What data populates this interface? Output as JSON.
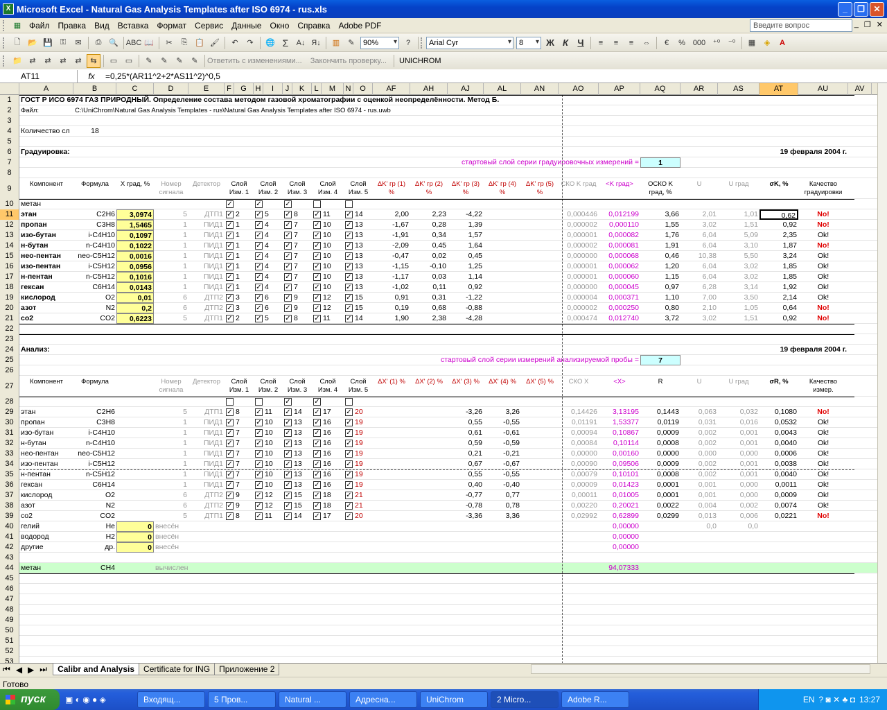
{
  "window": {
    "title": "Microsoft Excel - Natural Gas Analysis Templates after ISO 6974 - rus.xls"
  },
  "menu": [
    "Файл",
    "Правка",
    "Вид",
    "Вставка",
    "Формат",
    "Сервис",
    "Данные",
    "Окно",
    "Справка",
    "Adobe PDF"
  ],
  "ask_placeholder": "Введите вопрос",
  "toolbar": {
    "zoom": "90%",
    "font": "Arial Cyr",
    "size": "8",
    "bold": "Ж",
    "italic": "К",
    "underline": "Ч",
    "percent": "%",
    "thousands": "000",
    "sum": "Σ",
    "review_reply": "Ответить с изменениями...",
    "review_end": "Закончить проверку...",
    "unichrom": "UNICHROM"
  },
  "formula_bar": {
    "cell": "AT11",
    "fx": "fx",
    "formula": "=0,25*(AR11^2+2*AS11^2)^0,5"
  },
  "columns": [
    {
      "n": "A",
      "w": 78
    },
    {
      "n": "B",
      "w": 62
    },
    {
      "n": "C",
      "w": 54
    },
    {
      "n": "D",
      "w": 50
    },
    {
      "n": "E",
      "w": 52
    },
    {
      "n": "F",
      "w": 14
    },
    {
      "n": "G",
      "w": 28
    },
    {
      "n": "H",
      "w": 14
    },
    {
      "n": "I",
      "w": 28
    },
    {
      "n": "J",
      "w": 14
    },
    {
      "n": "K",
      "w": 28
    },
    {
      "n": "L",
      "w": 14
    },
    {
      "n": "M",
      "w": 32
    },
    {
      "n": "N",
      "w": 14
    },
    {
      "n": "O",
      "w": 28
    },
    {
      "n": "AF",
      "w": 54
    },
    {
      "n": "AH",
      "w": 54
    },
    {
      "n": "AJ",
      "w": 52
    },
    {
      "n": "AL",
      "w": 54
    },
    {
      "n": "AN",
      "w": 54
    },
    {
      "n": "AO",
      "w": 58
    },
    {
      "n": "AP",
      "w": 60
    },
    {
      "n": "AQ",
      "w": 58
    },
    {
      "n": "AR",
      "w": 54
    },
    {
      "n": "AS",
      "w": 60
    },
    {
      "n": "AT",
      "w": 56
    },
    {
      "n": "AU",
      "w": 72
    },
    {
      "n": "AV",
      "w": 34
    }
  ],
  "selected_col": "AT",
  "selected_row": 11,
  "sheet": {
    "r1": "ГОСТ Р ИСО 6974 ГАЗ ПРИРОДНЫЙ. Определение состава методом газовой хроматографии с оценкой неопределённости. Метод Б.",
    "r2_label": "Файл:",
    "r2_path": "C:\\UniChrom\\Natural Gas Analysis Templates - rus\\Natural Gas Analysis Templates after ISO 6974 - rus.uwb",
    "r4_label": "Количество сл",
    "r4_value": "18",
    "r6_label": "Градуировка:",
    "date": "19 февраля 2004 г.",
    "r7_label": "стартовый слой серии градуировочных измерений =",
    "r7_value": "1",
    "r24_label": "Анализ:",
    "r25_label": "стартовый слой серии измерений анализируемой пробы =",
    "r25_value": "7",
    "h9": [
      "Компонент",
      "Формула",
      "X град, %",
      "Номер сигнала",
      "Детектор",
      "Слой Изм. 1",
      "Слой Изм. 2",
      "Слой Изм. 3",
      "Слой Изм. 4",
      "Слой Изм. 5",
      "ΔK' гр (1) %",
      "ΔK' гр (2) %",
      "ΔK' гр (3) %",
      "ΔK' гр (4) %",
      "ΔK' гр (5) %",
      "СКО K град",
      "<K град>",
      "ОСКО K град, %",
      "U",
      "U град",
      "σK, %",
      "Качество градуировки"
    ],
    "h27": [
      "Компонент",
      "Формула",
      "",
      "Номер сигнала",
      "Детектор",
      "Слой Изм. 1",
      "Слой Изм. 2",
      "Слой Изм. 3",
      "Слой Изм. 4",
      "Слой Изм. 5",
      "ΔX' (1) %",
      "ΔX' (2) %",
      "ΔX' (3) %",
      "ΔX' (4) %",
      "ΔX' (5) %",
      "СКО X",
      "<X>",
      "R",
      "U",
      "U град",
      "σR, %",
      "Качество измер."
    ],
    "r10": "метан",
    "calib": [
      {
        "row": 11,
        "name": "этан",
        "f": "C2H6",
        "x": "3,0974",
        "sig": "5",
        "det": "ДТП1",
        "s": [
          "2",
          "5",
          "8",
          "11",
          "14"
        ],
        "d1": "2,00",
        "d2": "2,23",
        "d3": "-4,22",
        "sko": "0,000446",
        "k": "0,012199",
        "osko": "3,66",
        "u": "2,01",
        "ug": "1,01",
        "sig2": "0,62",
        "q": "No!"
      },
      {
        "row": 12,
        "name": "пропан",
        "f": "C3H8",
        "x": "1,5465",
        "sig": "1",
        "det": "ПИД1",
        "s": [
          "1",
          "4",
          "7",
          "10",
          "13"
        ],
        "d1": "-1,67",
        "d2": "0,28",
        "d3": "1,39",
        "sko": "0,000002",
        "k": "0,000110",
        "osko": "1,55",
        "u": "3,02",
        "ug": "1,51",
        "sig2": "0,92",
        "q": "No!"
      },
      {
        "row": 13,
        "name": "изо-бутан",
        "f": "i-C4H10",
        "x": "0,1097",
        "sig": "1",
        "det": "ПИД1",
        "s": [
          "1",
          "4",
          "7",
          "10",
          "13"
        ],
        "d1": "-1,91",
        "d2": "0,34",
        "d3": "1,57",
        "sko": "0,000001",
        "k": "0,000082",
        "osko": "1,76",
        "u": "6,04",
        "ug": "5,09",
        "sig2": "2,35",
        "q": "Ok!"
      },
      {
        "row": 14,
        "name": "н-бутан",
        "f": "n-C4H10",
        "x": "0,1022",
        "sig": "1",
        "det": "ПИД1",
        "s": [
          "1",
          "4",
          "7",
          "10",
          "13"
        ],
        "d1": "-2,09",
        "d2": "0,45",
        "d3": "1,64",
        "sko": "0,000002",
        "k": "0,000081",
        "osko": "1,91",
        "u": "6,04",
        "ug": "3,10",
        "sig2": "1,87",
        "q": "No!"
      },
      {
        "row": 15,
        "name": "нео-пентан",
        "f": "neo-C5H12",
        "x": "0,0016",
        "sig": "1",
        "det": "ПИД1",
        "s": [
          "1",
          "4",
          "7",
          "10",
          "13"
        ],
        "d1": "-0,47",
        "d2": "0,02",
        "d3": "0,45",
        "sko": "0,000000",
        "k": "0,000068",
        "osko": "0,46",
        "u": "10,38",
        "ug": "5,50",
        "sig2": "3,24",
        "q": "Ok!"
      },
      {
        "row": 16,
        "name": "изо-пентан",
        "f": "i-C5H12",
        "x": "0,0956",
        "sig": "1",
        "det": "ПИД1",
        "s": [
          "1",
          "4",
          "7",
          "10",
          "13"
        ],
        "d1": "-1,15",
        "d2": "-0,10",
        "d3": "1,25",
        "sko": "0,000001",
        "k": "0,000062",
        "osko": "1,20",
        "u": "6,04",
        "ug": "3,02",
        "sig2": "1,85",
        "q": "Ok!"
      },
      {
        "row": 17,
        "name": "н-пентан",
        "f": "n-C5H12",
        "x": "0,1016",
        "sig": "1",
        "det": "ПИД1",
        "s": [
          "1",
          "4",
          "7",
          "10",
          "13"
        ],
        "d1": "-1,17",
        "d2": "0,03",
        "d3": "1,14",
        "sko": "0,000001",
        "k": "0,000060",
        "osko": "1,15",
        "u": "6,04",
        "ug": "3,02",
        "sig2": "1,85",
        "q": "Ok!"
      },
      {
        "row": 18,
        "name": "гексан",
        "f": "C6H14",
        "x": "0,0143",
        "sig": "1",
        "det": "ПИД1",
        "s": [
          "1",
          "4",
          "7",
          "10",
          "13"
        ],
        "d1": "-1,02",
        "d2": "0,11",
        "d3": "0,92",
        "sko": "0,000000",
        "k": "0,000045",
        "osko": "0,97",
        "u": "6,28",
        "ug": "3,14",
        "sig2": "1,92",
        "q": "Ok!"
      },
      {
        "row": 19,
        "name": "кислород",
        "f": "O2",
        "x": "0,01",
        "sig": "6",
        "det": "ДТП2",
        "s": [
          "3",
          "6",
          "9",
          "12",
          "15"
        ],
        "d1": "0,91",
        "d2": "0,31",
        "d3": "-1,22",
        "sko": "0,000004",
        "k": "0,000371",
        "osko": "1,10",
        "u": "7,00",
        "ug": "3,50",
        "sig2": "2,14",
        "q": "Ok!"
      },
      {
        "row": 20,
        "name": "азот",
        "f": "N2",
        "x": "0,2",
        "sig": "6",
        "det": "ДТП2",
        "s": [
          "3",
          "6",
          "9",
          "12",
          "15"
        ],
        "d1": "0,19",
        "d2": "0,68",
        "d3": "-0,88",
        "sko": "0,000002",
        "k": "0,000250",
        "osko": "0,80",
        "u": "2,10",
        "ug": "1,05",
        "sig2": "0,64",
        "q": "No!"
      },
      {
        "row": 21,
        "name": "co2",
        "f": "CO2",
        "x": "0,6223",
        "sig": "5",
        "det": "ДТП1",
        "s": [
          "2",
          "5",
          "8",
          "11",
          "14"
        ],
        "d1": "1,90",
        "d2": "2,38",
        "d3": "-4,28",
        "sko": "0,000474",
        "k": "0,012740",
        "osko": "3,72",
        "u": "3,02",
        "ug": "1,51",
        "sig2": "0,92",
        "q": "No!"
      }
    ],
    "analysis": [
      {
        "row": 29,
        "name": "этан",
        "f": "C2H6",
        "sig": "5",
        "det": "ДТП1",
        "s": [
          "8",
          "11",
          "14",
          "17",
          "20"
        ],
        "d3": "-3,26",
        "d4": "3,26",
        "sko": "0,14426",
        "x": "3,13195",
        "r": "0,1443",
        "u": "0,063",
        "ug": "0,032",
        "sig2": "0,1080",
        "q": "No!"
      },
      {
        "row": 30,
        "name": "пропан",
        "f": "C3H8",
        "sig": "1",
        "det": "ПИД1",
        "s": [
          "7",
          "10",
          "13",
          "16",
          "19"
        ],
        "d3": "0,55",
        "d4": "-0,55",
        "sko": "0,01191",
        "x": "1,53377",
        "r": "0,0119",
        "u": "0,031",
        "ug": "0,016",
        "sig2": "0,0532",
        "q": "Ok!"
      },
      {
        "row": 31,
        "name": "изо-бутан",
        "f": "i-C4H10",
        "sig": "1",
        "det": "ПИД1",
        "s": [
          "7",
          "10",
          "13",
          "16",
          "19"
        ],
        "d3": "0,61",
        "d4": "-0,61",
        "sko": "0,00094",
        "x": "0,10867",
        "r": "0,0009",
        "u": "0,002",
        "ug": "0,001",
        "sig2": "0,0043",
        "q": "Ok!"
      },
      {
        "row": 32,
        "name": "н-бутан",
        "f": "n-C4H10",
        "sig": "1",
        "det": "ПИД1",
        "s": [
          "7",
          "10",
          "13",
          "16",
          "19"
        ],
        "d3": "0,59",
        "d4": "-0,59",
        "sko": "0,00084",
        "x": "0,10114",
        "r": "0,0008",
        "u": "0,002",
        "ug": "0,001",
        "sig2": "0,0040",
        "q": "Ok!"
      },
      {
        "row": 33,
        "name": "нео-пентан",
        "f": "neo-C5H12",
        "sig": "1",
        "det": "ПИД1",
        "s": [
          "7",
          "10",
          "13",
          "16",
          "19"
        ],
        "d3": "0,21",
        "d4": "-0,21",
        "sko": "0,00000",
        "x": "0,00160",
        "r": "0,0000",
        "u": "0,000",
        "ug": "0,000",
        "sig2": "0,0006",
        "q": "Ok!"
      },
      {
        "row": 34,
        "name": "изо-пентан",
        "f": "i-C5H12",
        "sig": "1",
        "det": "ПИД1",
        "s": [
          "7",
          "10",
          "13",
          "16",
          "19"
        ],
        "d3": "0,67",
        "d4": "-0,67",
        "sko": "0,00090",
        "x": "0,09506",
        "r": "0,0009",
        "u": "0,002",
        "ug": "0,001",
        "sig2": "0,0038",
        "q": "Ok!"
      },
      {
        "row": 35,
        "name": "н-пентан",
        "f": "n-C5H12",
        "sig": "1",
        "det": "ПИД1",
        "s": [
          "7",
          "10",
          "13",
          "16",
          "19"
        ],
        "d3": "0,55",
        "d4": "-0,55",
        "sko": "0,00079",
        "x": "0,10101",
        "r": "0,0008",
        "u": "0,002",
        "ug": "0,001",
        "sig2": "0,0040",
        "q": "Ok!"
      },
      {
        "row": 36,
        "name": "гексан",
        "f": "C6H14",
        "sig": "1",
        "det": "ПИД1",
        "s": [
          "7",
          "10",
          "13",
          "16",
          "19"
        ],
        "d3": "0,40",
        "d4": "-0,40",
        "sko": "0,00009",
        "x": "0,01423",
        "r": "0,0001",
        "u": "0,001",
        "ug": "0,000",
        "sig2": "0,0011",
        "q": "Ok!"
      },
      {
        "row": 37,
        "name": "кислород",
        "f": "O2",
        "sig": "6",
        "det": "ДТП2",
        "s": [
          "9",
          "12",
          "15",
          "18",
          "21"
        ],
        "d3": "-0,77",
        "d4": "0,77",
        "sko": "0,00011",
        "x": "0,01005",
        "r": "0,0001",
        "u": "0,001",
        "ug": "0,000",
        "sig2": "0,0009",
        "q": "Ok!"
      },
      {
        "row": 38,
        "name": "азот",
        "f": "N2",
        "sig": "6",
        "det": "ДТП2",
        "s": [
          "9",
          "12",
          "15",
          "18",
          "21"
        ],
        "d3": "-0,78",
        "d4": "0,78",
        "sko": "0,00220",
        "x": "0,20021",
        "r": "0,0022",
        "u": "0,004",
        "ug": "0,002",
        "sig2": "0,0074",
        "q": "Ok!"
      },
      {
        "row": 39,
        "name": "co2",
        "f": "CO2",
        "sig": "5",
        "det": "ДТП1",
        "s": [
          "8",
          "11",
          "14",
          "17",
          "20"
        ],
        "d3": "-3,36",
        "d4": "3,36",
        "sko": "0,02992",
        "x": "0,62899",
        "r": "0,0299",
        "u": "0,013",
        "ug": "0,006",
        "sig2": "0,0221",
        "q": "No!"
      }
    ],
    "extra": [
      {
        "row": 40,
        "name": "гелий",
        "f": "He",
        "v": "0",
        "note": "внесён",
        "x": "0,00000",
        "u": "0,0",
        "ug": "0,0"
      },
      {
        "row": 41,
        "name": "водород",
        "f": "H2",
        "v": "0",
        "note": "внесён",
        "x": "0,00000"
      },
      {
        "row": 42,
        "name": "другие",
        "f": "др.",
        "v": "0",
        "note": "внесён",
        "x": "0,00000"
      }
    ],
    "r44": {
      "name": "метан",
      "f": "CH4",
      "note": "вычислен",
      "x": "94,07333"
    }
  },
  "tabs": [
    "Calibr and Analysis",
    "Certificate for ING",
    "Приложение 2"
  ],
  "status": "Готово",
  "taskbar": {
    "start": "пуск",
    "tasks": [
      "Входящ...",
      "5 Пров...",
      "Natural ...",
      "Адресна...",
      "UniChrom",
      "2 Micro...",
      "Adobe R..."
    ],
    "lang": "EN",
    "clock": "13:27"
  }
}
